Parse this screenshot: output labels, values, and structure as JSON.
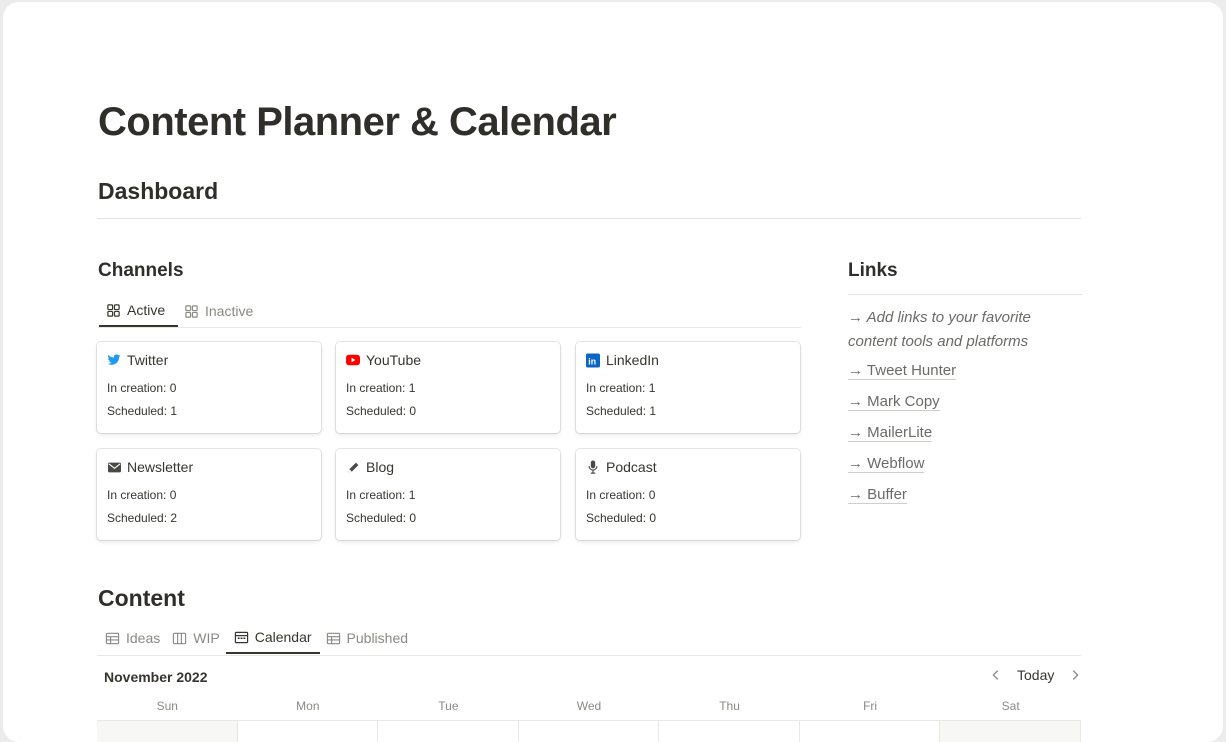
{
  "page": {
    "title": "Content Planner & Calendar",
    "section_dashboard": "Dashboard"
  },
  "channels": {
    "heading": "Channels",
    "tabs": [
      {
        "label": "Active",
        "icon": "gallery-icon",
        "active": true
      },
      {
        "label": "Inactive",
        "icon": "gallery-icon",
        "active": false
      }
    ],
    "cards": [
      {
        "name": "Twitter",
        "icon": "twitter-icon",
        "in_creation": "In creation: 0",
        "scheduled": "Scheduled: 1"
      },
      {
        "name": "YouTube",
        "icon": "youtube-icon",
        "in_creation": "In creation: 1",
        "scheduled": "Scheduled: 0"
      },
      {
        "name": "LinkedIn",
        "icon": "linkedin-icon",
        "in_creation": "In creation: 1",
        "scheduled": "Scheduled: 1"
      },
      {
        "name": "Newsletter",
        "icon": "envelope-icon",
        "in_creation": "In creation: 0",
        "scheduled": "Scheduled: 2"
      },
      {
        "name": "Blog",
        "icon": "pencil-icon",
        "in_creation": "In creation: 1",
        "scheduled": "Scheduled: 0"
      },
      {
        "name": "Podcast",
        "icon": "microphone-icon",
        "in_creation": "In creation: 0",
        "scheduled": "Scheduled: 0"
      }
    ]
  },
  "links": {
    "heading": "Links",
    "note_line1": "→ Add links to your favorite",
    "note_line2": "content tools and platforms",
    "items": [
      "→ Tweet Hunter",
      "→ Mark Copy",
      "→ MailerLite",
      "→ Webflow",
      "→ Buffer"
    ]
  },
  "content": {
    "heading": "Content",
    "tabs": [
      {
        "label": "Ideas",
        "icon": "table-icon",
        "active": false
      },
      {
        "label": "WIP",
        "icon": "board-icon",
        "active": false
      },
      {
        "label": "Calendar",
        "icon": "calendar-icon",
        "active": true
      },
      {
        "label": "Published",
        "icon": "table-icon",
        "active": false
      }
    ]
  },
  "calendar": {
    "month": "November 2022",
    "today_label": "Today",
    "weekdays": [
      "Sun",
      "Mon",
      "Tue",
      "Wed",
      "Thu",
      "Fri",
      "Sat"
    ]
  },
  "colors": {
    "twitter": "#1d9bf0",
    "youtube": "#ff0000",
    "linkedin": "#0a66c2",
    "text": "#37352f",
    "muted": "#8a8984"
  }
}
